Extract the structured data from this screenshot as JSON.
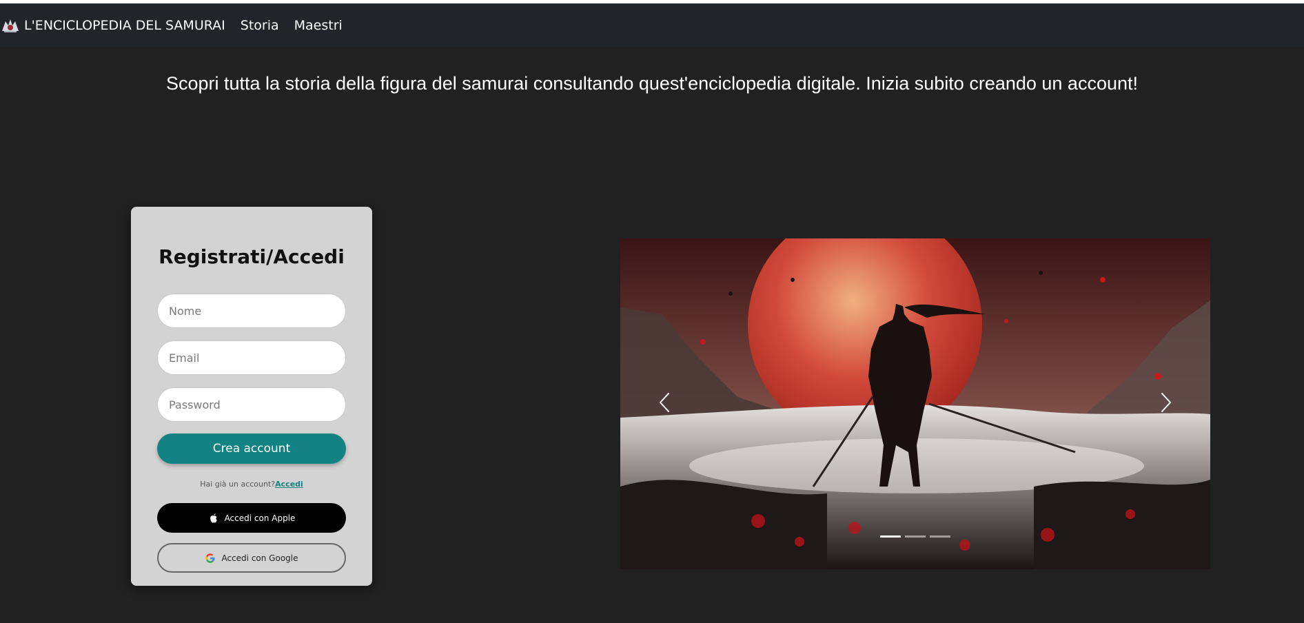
{
  "navbar": {
    "brand": "L'ENCICLOPEDIA DEL SAMURAI",
    "links": [
      "Storia",
      "Maestri"
    ]
  },
  "tagline": "Scopri tutta la storia della figura del samurai consultando quest'enciclopedia digitale. Inizia subito creando un account!",
  "form": {
    "title": "Registrati/Accedi",
    "name_placeholder": "Nome",
    "email_placeholder": "Email",
    "password_placeholder": "Password",
    "create_label": "Crea account",
    "login_hint": "Hai già un account?",
    "login_link": "Accedi",
    "apple_label": "Accedi con Apple",
    "google_label": "Accedi con Google"
  },
  "carousel": {
    "slide_count": 3,
    "active_index": 0,
    "prev_icon": "chevron-left-icon",
    "next_icon": "chevron-right-icon"
  },
  "colors": {
    "accent": "#138282",
    "background": "#212121",
    "navbar": "#212529",
    "card": "#d3d3d3"
  }
}
